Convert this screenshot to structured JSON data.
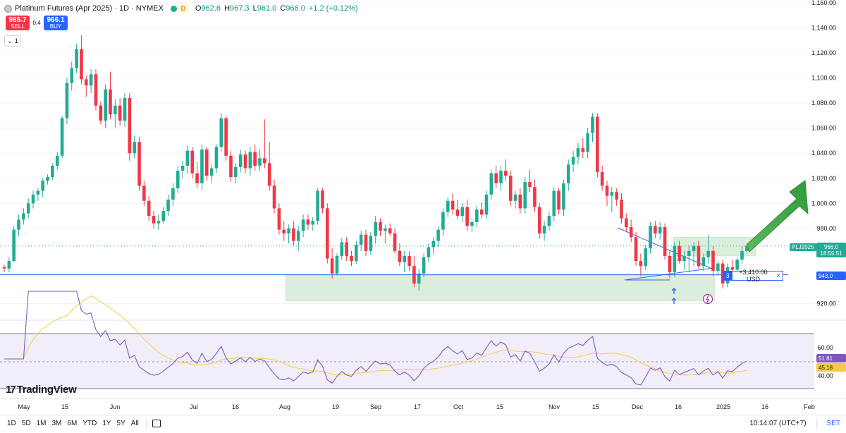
{
  "header": {
    "title": "Platinum Futures (Apr 2025) · 1D · NYMEX",
    "status_badge": "D",
    "ohlc": {
      "o_label": "O",
      "o": "962.6",
      "h_label": "H",
      "h": "967.3",
      "l_label": "L",
      "l": "961.0",
      "c_label": "C",
      "c": "966.0",
      "change": "+1.2 (+0.12%)"
    }
  },
  "trade": {
    "sell_price": "965.7",
    "sell_label": "SELL",
    "spread": "0.4",
    "buy_price": "966.1",
    "buy_label": "BUY"
  },
  "collapse": {
    "count": "1",
    "icon": "chevron-down-icon"
  },
  "position": {
    "qty": "3",
    "pnl": "+3,410.00 USD",
    "close": "×"
  },
  "price_scale": {
    "labels": [
      "1,160.00",
      "1,140.00",
      "1,120.00",
      "1,100.00",
      "1,080.00",
      "1,060.00",
      "1,040.00",
      "1,020.00",
      "1,000.00",
      "980.00",
      "920.00"
    ],
    "symbol_tag": "PLJ2025",
    "last_price": "966.0",
    "countdown": "18:55:51",
    "position_price": "943.0"
  },
  "rsi": {
    "labels": [
      "60.00",
      "40.00"
    ],
    "value": "51.81",
    "ma_value": "45.18"
  },
  "time_axis": [
    "May",
    "15",
    "Jun",
    "Jul",
    "16",
    "Aug",
    "19",
    "Sep",
    "17",
    "Oct",
    "15",
    "Nov",
    "15",
    "Dec",
    "16",
    "2025",
    "16",
    "Feb"
  ],
  "brand": {
    "mark": "17",
    "name": "TradingView"
  },
  "toolbar": {
    "ranges": [
      "1D",
      "5D",
      "1M",
      "3M",
      "6M",
      "YTD",
      "1Y",
      "5Y",
      "All"
    ],
    "time": "10:14:07 (UTC+7)",
    "settings": "SET"
  },
  "colors": {
    "up": "#22ab94",
    "down": "#f23645",
    "accent": "#2962ff",
    "rsi_line": "#7e57c2",
    "rsi_ma": "#f7c948",
    "zone": "#c8e6c9",
    "arrow": "#4caf50"
  },
  "chart_data": {
    "type": "candlestick",
    "instrument": "Platinum Futures (Apr 2025)",
    "interval": "1D",
    "ylim": [
      918,
      1162
    ],
    "last_close": 966.0,
    "position_line": 943.0,
    "candles": [
      [
        949,
        951,
        945,
        948
      ],
      [
        948,
        957,
        945,
        954
      ],
      [
        954,
        982,
        953,
        979
      ],
      [
        979,
        991,
        974,
        987
      ],
      [
        987,
        996,
        983,
        992
      ],
      [
        992,
        1004,
        988,
        1000
      ],
      [
        1000,
        1010,
        996,
        1007
      ],
      [
        1007,
        1012,
        1002,
        1010
      ],
      [
        1010,
        1020,
        1005,
        1018
      ],
      [
        1018,
        1023,
        1015,
        1021
      ],
      [
        1021,
        1032,
        1019,
        1030
      ],
      [
        1030,
        1041,
        1027,
        1038
      ],
      [
        1038,
        1070,
        1036,
        1068
      ],
      [
        1068,
        1100,
        1063,
        1096
      ],
      [
        1096,
        1113,
        1090,
        1108
      ],
      [
        1108,
        1127,
        1104,
        1123
      ],
      [
        1123,
        1134,
        1095,
        1099
      ],
      [
        1099,
        1102,
        1085,
        1094
      ],
      [
        1094,
        1107,
        1088,
        1103
      ],
      [
        1103,
        1107,
        1074,
        1078
      ],
      [
        1078,
        1081,
        1063,
        1066
      ],
      [
        1066,
        1095,
        1060,
        1091
      ],
      [
        1091,
        1105,
        1067,
        1071
      ],
      [
        1071,
        1083,
        1060,
        1078
      ],
      [
        1078,
        1084,
        1062,
        1066
      ],
      [
        1066,
        1088,
        1061,
        1084
      ],
      [
        1084,
        1088,
        1034,
        1040
      ],
      [
        1040,
        1054,
        1036,
        1049
      ],
      [
        1049,
        1053,
        1010,
        1014
      ],
      [
        1014,
        1018,
        998,
        1002
      ],
      [
        1002,
        1006,
        986,
        990
      ],
      [
        990,
        994,
        980,
        984
      ],
      [
        984,
        991,
        979,
        986
      ],
      [
        986,
        997,
        984,
        994
      ],
      [
        994,
        1007,
        990,
        1003
      ],
      [
        1003,
        1016,
        998,
        1012
      ],
      [
        1012,
        1030,
        1008,
        1026
      ],
      [
        1026,
        1034,
        1020,
        1030
      ],
      [
        1030,
        1046,
        1024,
        1042
      ],
      [
        1042,
        1045,
        1020,
        1024
      ],
      [
        1024,
        1033,
        1012,
        1016
      ],
      [
        1016,
        1047,
        1010,
        1043
      ],
      [
        1043,
        1045,
        1018,
        1022
      ],
      [
        1022,
        1031,
        1016,
        1028
      ],
      [
        1028,
        1047,
        1024,
        1045
      ],
      [
        1045,
        1072,
        1041,
        1068
      ],
      [
        1068,
        1070,
        1034,
        1038
      ],
      [
        1038,
        1042,
        1017,
        1021
      ],
      [
        1021,
        1032,
        1016,
        1029
      ],
      [
        1029,
        1043,
        1025,
        1039
      ],
      [
        1039,
        1042,
        1024,
        1028
      ],
      [
        1028,
        1045,
        1022,
        1041
      ],
      [
        1041,
        1047,
        1026,
        1030
      ],
      [
        1030,
        1043,
        1026,
        1036
      ],
      [
        1036,
        1067,
        1028,
        1032
      ],
      [
        1032,
        1049,
        1010,
        1014
      ],
      [
        1014,
        1019,
        992,
        996
      ],
      [
        996,
        1000,
        975,
        979
      ],
      [
        979,
        986,
        970,
        976
      ],
      [
        976,
        983,
        968,
        980
      ],
      [
        980,
        986,
        966,
        970
      ],
      [
        970,
        982,
        962,
        978
      ],
      [
        978,
        991,
        973,
        987
      ],
      [
        987,
        991,
        979,
        983
      ],
      [
        983,
        989,
        978,
        986
      ],
      [
        986,
        1012,
        983,
        1010
      ],
      [
        1010,
        1012,
        992,
        996
      ],
      [
        996,
        1000,
        952,
        956
      ],
      [
        956,
        964,
        940,
        944
      ],
      [
        944,
        960,
        943,
        958
      ],
      [
        958,
        972,
        955,
        969
      ],
      [
        969,
        973,
        954,
        958
      ],
      [
        958,
        962,
        950,
        954
      ],
      [
        954,
        970,
        952,
        967
      ],
      [
        967,
        978,
        962,
        975
      ],
      [
        975,
        979,
        958,
        962
      ],
      [
        962,
        977,
        959,
        974
      ],
      [
        974,
        990,
        968,
        985
      ],
      [
        985,
        988,
        974,
        978
      ],
      [
        978,
        983,
        968,
        980
      ],
      [
        980,
        984,
        974,
        976
      ],
      [
        976,
        980,
        960,
        962
      ],
      [
        962,
        968,
        950,
        953
      ],
      [
        953,
        962,
        945,
        958
      ],
      [
        958,
        962,
        946,
        950
      ],
      [
        950,
        958,
        933,
        936
      ],
      [
        936,
        948,
        930,
        944
      ],
      [
        944,
        960,
        941,
        957
      ],
      [
        957,
        968,
        953,
        965
      ],
      [
        965,
        973,
        959,
        970
      ],
      [
        970,
        982,
        965,
        979
      ],
      [
        979,
        996,
        974,
        993
      ],
      [
        993,
        1005,
        989,
        1002
      ],
      [
        1002,
        1008,
        991,
        995
      ],
      [
        995,
        1003,
        987,
        990
      ],
      [
        990,
        1000,
        985,
        997
      ],
      [
        997,
        1003,
        978,
        982
      ],
      [
        982,
        988,
        977,
        985
      ],
      [
        985,
        998,
        981,
        995
      ],
      [
        995,
        1001,
        988,
        991
      ],
      [
        991,
        1010,
        987,
        1007
      ],
      [
        1007,
        1027,
        1003,
        1024
      ],
      [
        1024,
        1030,
        1012,
        1016
      ],
      [
        1016,
        1030,
        1010,
        1026
      ],
      [
        1026,
        1035,
        1018,
        1022
      ],
      [
        1022,
        1026,
        998,
        1002
      ],
      [
        1002,
        1010,
        996,
        1007
      ],
      [
        1007,
        1012,
        992,
        996
      ],
      [
        996,
        1021,
        992,
        1017
      ],
      [
        1017,
        1027,
        1009,
        1013
      ],
      [
        1013,
        1019,
        993,
        997
      ],
      [
        997,
        1000,
        972,
        976
      ],
      [
        976,
        986,
        970,
        982
      ],
      [
        982,
        993,
        978,
        990
      ],
      [
        990,
        1013,
        986,
        1010
      ],
      [
        1010,
        1012,
        991,
        995
      ],
      [
        995,
        1019,
        990,
        1016
      ],
      [
        1016,
        1035,
        1010,
        1031
      ],
      [
        1031,
        1042,
        1025,
        1037
      ],
      [
        1037,
        1048,
        1031,
        1044
      ],
      [
        1044,
        1052,
        1036,
        1041
      ],
      [
        1041,
        1060,
        1036,
        1056
      ],
      [
        1056,
        1072,
        1049,
        1069
      ],
      [
        1069,
        1072,
        1021,
        1025
      ],
      [
        1025,
        1030,
        1010,
        1014
      ],
      [
        1014,
        1018,
        998,
        1006
      ],
      [
        1006,
        1013,
        993,
        1009
      ],
      [
        1009,
        1012,
        998,
        1003
      ],
      [
        1003,
        1008,
        984,
        988
      ],
      [
        988,
        992,
        977,
        981
      ],
      [
        981,
        987,
        969,
        973
      ],
      [
        973,
        977,
        950,
        954
      ],
      [
        954,
        960,
        942,
        950
      ],
      [
        950,
        967,
        947,
        964
      ],
      [
        964,
        985,
        960,
        982
      ],
      [
        982,
        986,
        972,
        976
      ],
      [
        976,
        985,
        971,
        981
      ],
      [
        981,
        984,
        955,
        958
      ],
      [
        958,
        962,
        940,
        945
      ],
      [
        945,
        969,
        941,
        966
      ],
      [
        966,
        970,
        952,
        954
      ],
      [
        954,
        962,
        947,
        958
      ],
      [
        958,
        966,
        945,
        962
      ],
      [
        962,
        969,
        950,
        966
      ],
      [
        966,
        970,
        948,
        950
      ],
      [
        950,
        960,
        946,
        957
      ],
      [
        957,
        975,
        952,
        962
      ],
      [
        962,
        966,
        942,
        946
      ],
      [
        946,
        954,
        942,
        952
      ],
      [
        952,
        955,
        932,
        936
      ],
      [
        936,
        952,
        933,
        949
      ],
      [
        949,
        955,
        944,
        947
      ],
      [
        947,
        957,
        939,
        955
      ],
      [
        955,
        966,
        952,
        962
      ],
      [
        962,
        967,
        961,
        966
      ]
    ],
    "rsi": {
      "ylim": [
        22,
        82
      ],
      "gridlines": [
        60,
        40
      ],
      "last": 51.81,
      "ma_last": 45.18
    },
    "annotations": {
      "zones": [
        {
          "from": 922,
          "to": 943
        },
        {
          "from": 958,
          "to": 973
        }
      ],
      "arrow": "up-right"
    }
  }
}
